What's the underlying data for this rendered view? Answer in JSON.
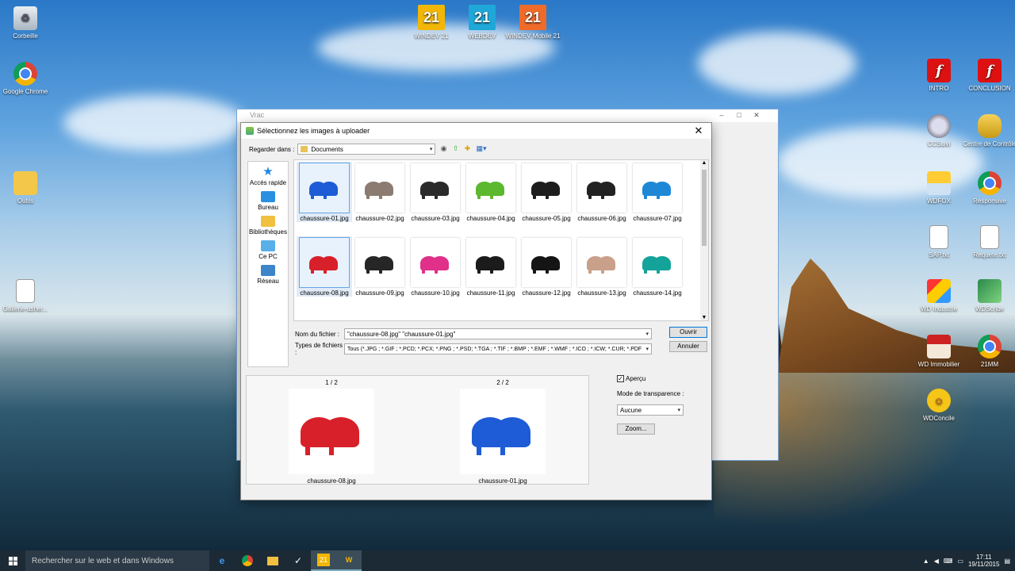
{
  "desktop": {
    "icons_left": [
      {
        "label": "Corbeille",
        "icon": "recycle-bin-icon"
      },
      {
        "label": "Google Chrome",
        "icon": "chrome-icon"
      },
      {
        "label": "Outils",
        "icon": "folder-icon"
      },
      {
        "label": "Gallerie-usher...",
        "icon": "document-icon"
      }
    ],
    "icons_top": [
      {
        "label": "WINDEV 21",
        "icon": "windev-icon",
        "glyph": "21"
      },
      {
        "label": "WEBDEV",
        "icon": "webdev-icon",
        "glyph": "21"
      },
      {
        "label": "WINDEV Mobile 21",
        "icon": "windev-mobile-icon",
        "glyph": "21"
      }
    ],
    "icons_right": [
      {
        "label": "INTRO",
        "icon": "flash-icon"
      },
      {
        "label": "CONCLUSION",
        "icon": "flash-icon"
      },
      {
        "label": "CCSuivi",
        "icon": "ccsuivi-icon"
      },
      {
        "label": "Centre de Contrôle",
        "icon": "database-icon"
      },
      {
        "label": "WDFOX",
        "icon": "weather-icon"
      },
      {
        "label": "Responsive",
        "icon": "chrome-icon"
      },
      {
        "label": "SAP.txt",
        "icon": "text-file-icon"
      },
      {
        "label": "Requete.txt",
        "icon": "text-file-icon"
      },
      {
        "label": "WD Industrie",
        "icon": "industrie-icon"
      },
      {
        "label": "WDScribe",
        "icon": "pen-icon"
      },
      {
        "label": "WD Immobilier",
        "icon": "house-icon"
      },
      {
        "label": "21MM",
        "icon": "chrome-icon"
      },
      {
        "label": "WDConcile",
        "icon": "smiley-icon"
      }
    ]
  },
  "background_window": {
    "title": "Vrac"
  },
  "dialog": {
    "title": "Sélectionnez les images à uploader",
    "look_in_label": "Regarder dans :",
    "look_in_value": "Documents",
    "places": [
      {
        "label": "Accès rapide",
        "icon": "star-icon"
      },
      {
        "label": "Bureau",
        "icon": "desktop-icon"
      },
      {
        "label": "Bibliothèques",
        "icon": "library-icon"
      },
      {
        "label": "Ce PC",
        "icon": "computer-icon"
      },
      {
        "label": "Réseau",
        "icon": "network-icon"
      }
    ],
    "files": [
      {
        "name": "chaussure-01.jpg",
        "color": "#1e5bd6",
        "selected": true
      },
      {
        "name": "chaussure-02.jpg",
        "color": "#8b7b70",
        "selected": false
      },
      {
        "name": "chaussure-03.jpg",
        "color": "#2a2a2a",
        "selected": false
      },
      {
        "name": "chaussure-04.jpg",
        "color": "#5cb82e",
        "selected": false
      },
      {
        "name": "chaussure-05.jpg",
        "color": "#1d1d1d",
        "selected": false
      },
      {
        "name": "chaussure-06.jpg",
        "color": "#222222",
        "selected": false
      },
      {
        "name": "chaussure-07.jpg",
        "color": "#1e88d6",
        "selected": false
      },
      {
        "name": "chaussure-08.jpg",
        "color": "#d8202a",
        "selected": true
      },
      {
        "name": "chaussure-09.jpg",
        "color": "#262626",
        "selected": false
      },
      {
        "name": "chaussure-10.jpg",
        "color": "#e0308a",
        "selected": false
      },
      {
        "name": "chaussure-11.jpg",
        "color": "#1b1b1b",
        "selected": false
      },
      {
        "name": "chaussure-12.jpg",
        "color": "#151515",
        "selected": false
      },
      {
        "name": "chaussure-13.jpg",
        "color": "#c9a08a",
        "selected": false
      },
      {
        "name": "chaussure-14.jpg",
        "color": "#14a39a",
        "selected": false
      }
    ],
    "filename_label": "Nom du fichier :",
    "filename_value": "\"chaussure-08.jpg\" \"chaussure-01.jpg\"",
    "filetype_label": "Types de fichiers :",
    "filetype_value": "Tous (*.JPG ; *.GIF ; *.PCD; *.PCX; *.PNG ; *.PSD; *.TGA ; *.TIF ; *.BMP ; *.EMF ; *.WMF ; *.ICO ; *.ICW; *.CUR; *.PDF",
    "open_label": "Ouvrir",
    "cancel_label": "Annuler",
    "preview": [
      {
        "counter": "1 / 2",
        "name": "chaussure-08.jpg",
        "color": "#d8202a"
      },
      {
        "counter": "2 / 2",
        "name": "chaussure-01.jpg",
        "color": "#1e5bd6"
      }
    ],
    "apercu_label": "Aperçu",
    "apercu_checked": true,
    "transparency_label": "Mode de transparence :",
    "transparency_value": "Aucune",
    "zoom_label": "Zoom..."
  },
  "taskbar": {
    "search_placeholder": "Rechercher sur le web et dans Windows",
    "apps": [
      "edge-icon",
      "chrome-icon",
      "explorer-icon",
      "app-icon",
      "windev-icon",
      "webdev-icon"
    ],
    "time": "17:11",
    "date": "19/11/2015"
  },
  "colors": {
    "accent": "#0078d7",
    "taskbar": "#1c2a35",
    "selection": "#e1ecf8"
  }
}
